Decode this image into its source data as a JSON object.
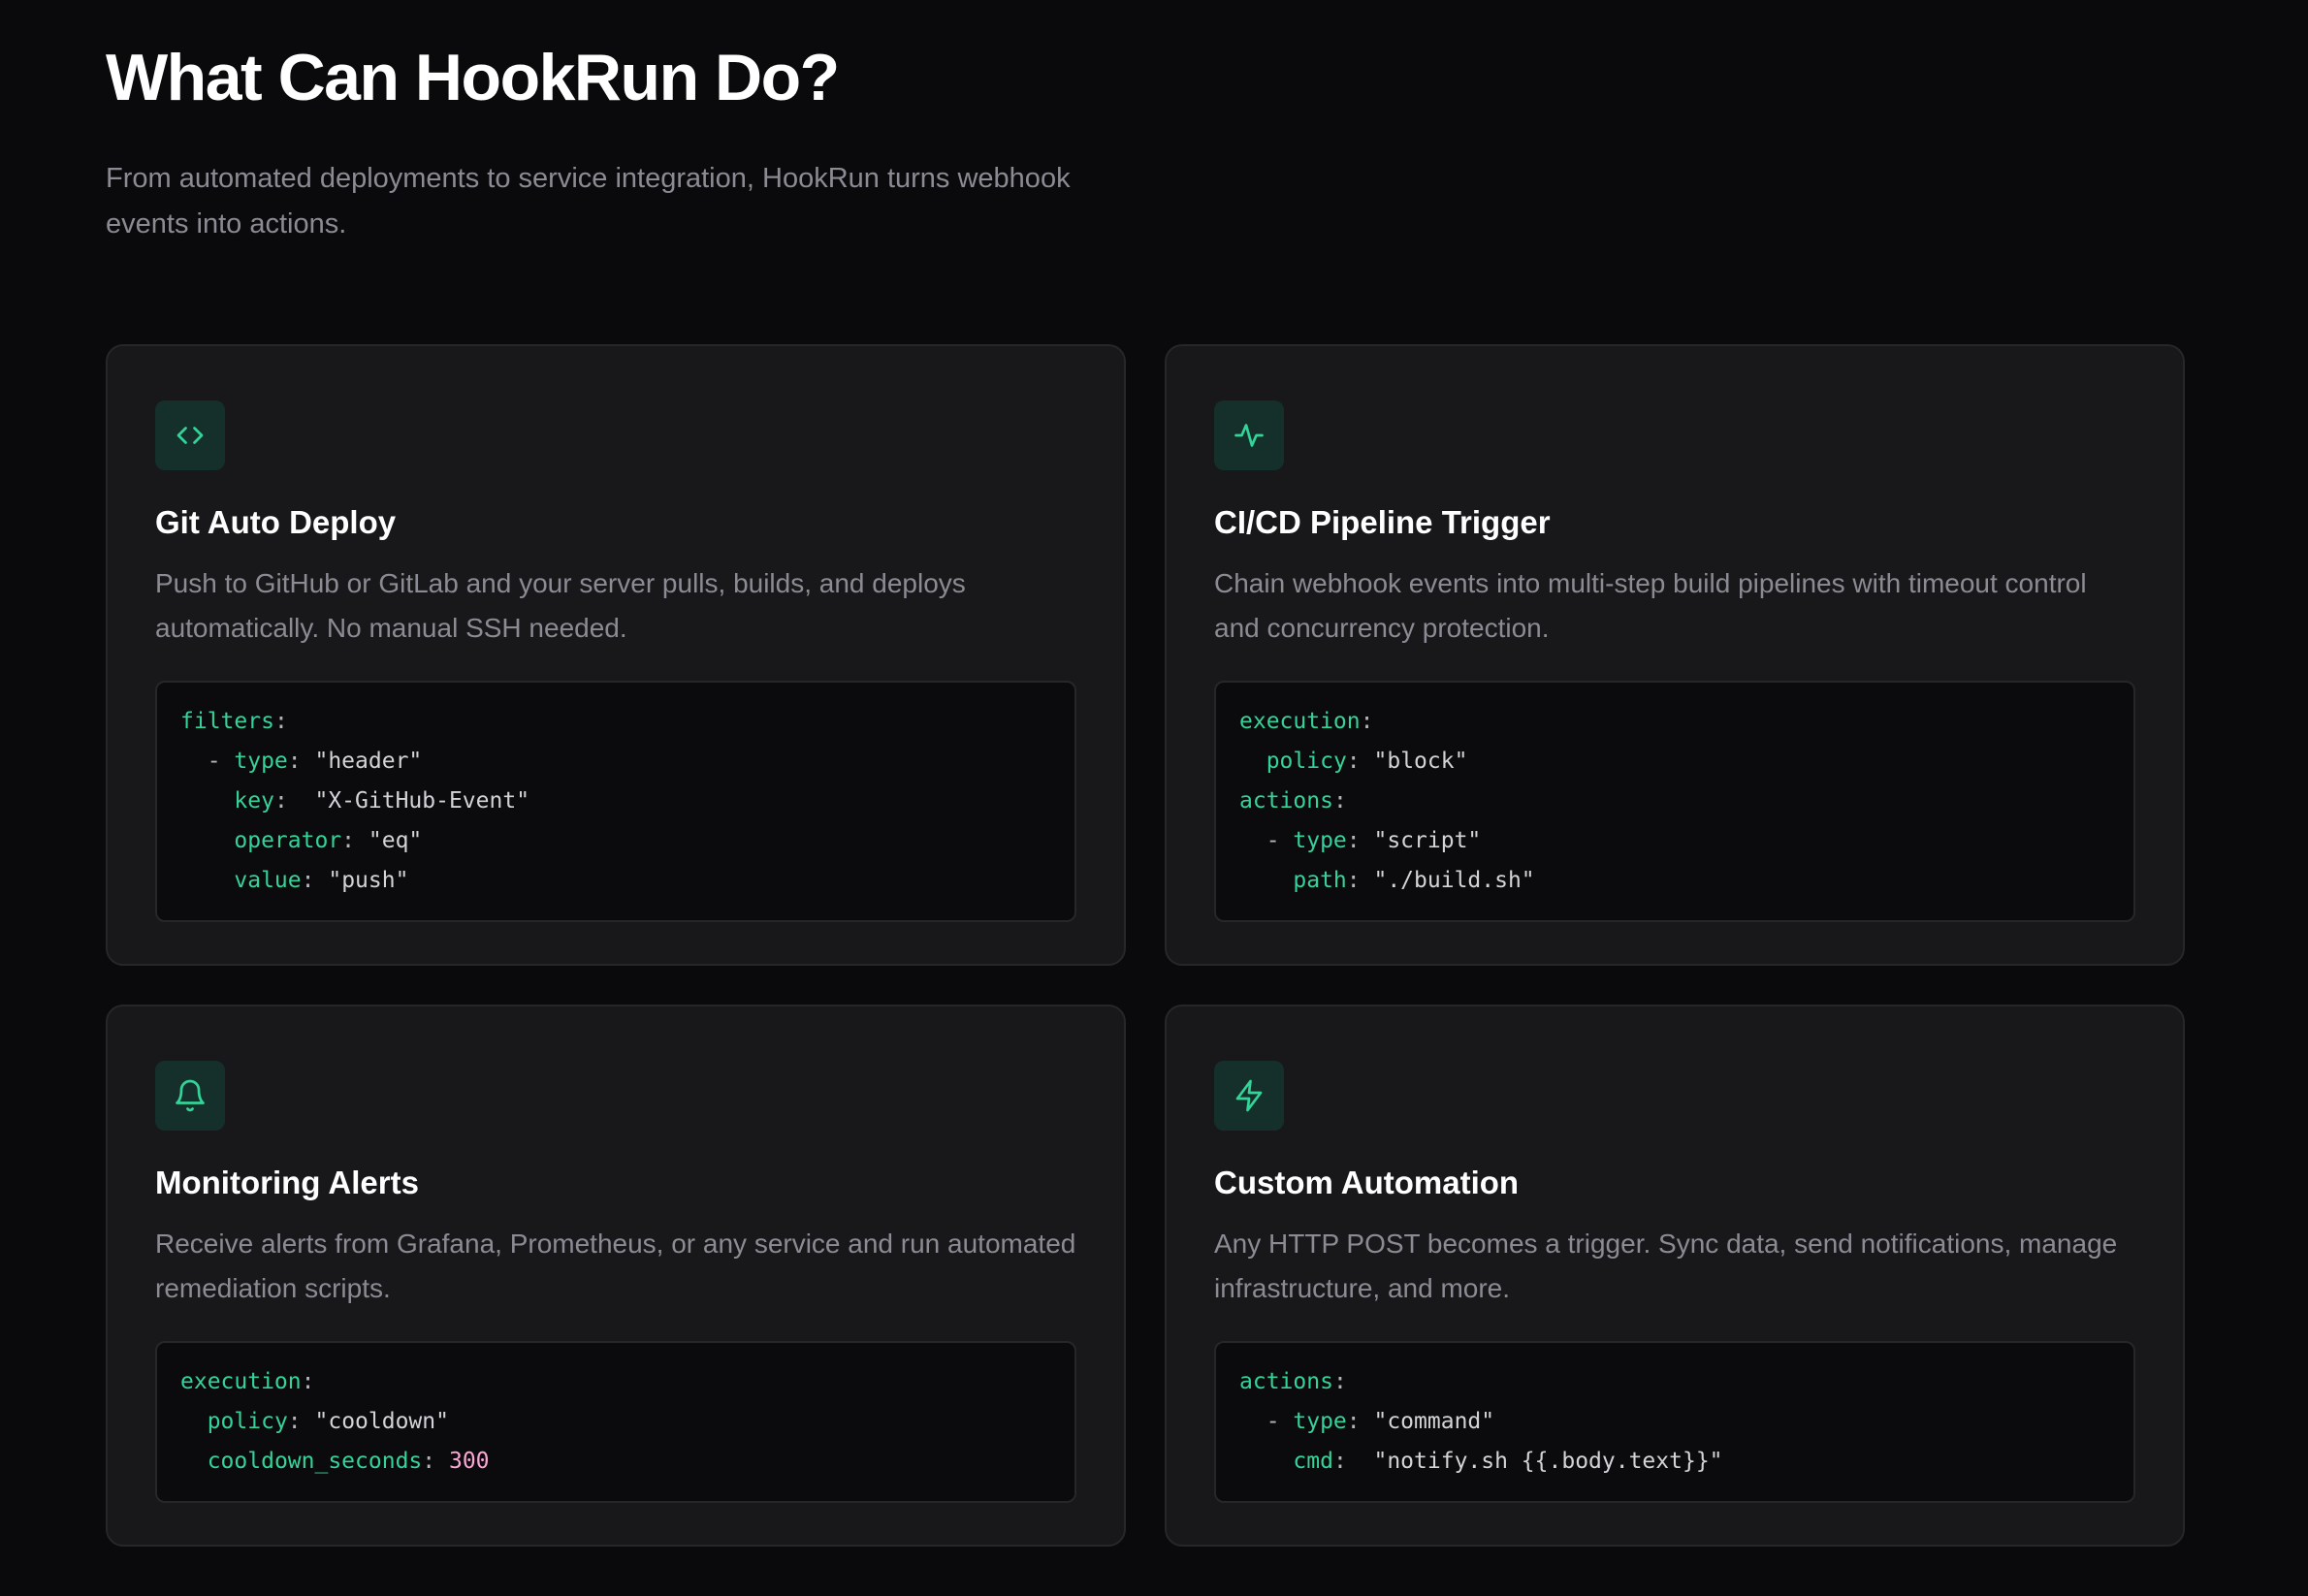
{
  "header": {
    "title": "What Can HookRun Do?",
    "subtitle": "From automated deployments to service integration, HookRun turns webhook events into actions."
  },
  "colors": {
    "background": "#0a0a0c",
    "card": "#18181b",
    "accent": "#34d399",
    "number": "#f9a8d4",
    "muted_text": "#8b8b93"
  },
  "cards": [
    {
      "icon": "code-icon",
      "title": "Git Auto Deploy",
      "description": "Push to GitHub or GitLab and your server pulls, builds, and deploys automatically. No manual SSH needed.",
      "code": [
        [
          {
            "t": "k",
            "v": "filters"
          },
          {
            "t": "p",
            "v": ":"
          }
        ],
        [
          {
            "t": "p",
            "v": "  - "
          },
          {
            "t": "k",
            "v": "type"
          },
          {
            "t": "p",
            "v": ": "
          },
          {
            "t": "s",
            "v": "\"header\""
          }
        ],
        [
          {
            "t": "p",
            "v": "    "
          },
          {
            "t": "k",
            "v": "key"
          },
          {
            "t": "p",
            "v": ":  "
          },
          {
            "t": "s",
            "v": "\"X-GitHub-Event\""
          }
        ],
        [
          {
            "t": "p",
            "v": "    "
          },
          {
            "t": "k",
            "v": "operator"
          },
          {
            "t": "p",
            "v": ": "
          },
          {
            "t": "s",
            "v": "\"eq\""
          }
        ],
        [
          {
            "t": "p",
            "v": "    "
          },
          {
            "t": "k",
            "v": "value"
          },
          {
            "t": "p",
            "v": ": "
          },
          {
            "t": "s",
            "v": "\"push\""
          }
        ]
      ]
    },
    {
      "icon": "activity-icon",
      "title": "CI/CD Pipeline Trigger",
      "description": "Chain webhook events into multi-step build pipelines with timeout control and concurrency protection.",
      "code": [
        [
          {
            "t": "k",
            "v": "execution"
          },
          {
            "t": "p",
            "v": ":"
          }
        ],
        [
          {
            "t": "p",
            "v": "  "
          },
          {
            "t": "k",
            "v": "policy"
          },
          {
            "t": "p",
            "v": ": "
          },
          {
            "t": "s",
            "v": "\"block\""
          }
        ],
        [
          {
            "t": "k",
            "v": "actions"
          },
          {
            "t": "p",
            "v": ":"
          }
        ],
        [
          {
            "t": "p",
            "v": "  - "
          },
          {
            "t": "k",
            "v": "type"
          },
          {
            "t": "p",
            "v": ": "
          },
          {
            "t": "s",
            "v": "\"script\""
          }
        ],
        [
          {
            "t": "p",
            "v": "    "
          },
          {
            "t": "k",
            "v": "path"
          },
          {
            "t": "p",
            "v": ": "
          },
          {
            "t": "s",
            "v": "\"./build.sh\""
          }
        ]
      ]
    },
    {
      "icon": "bell-icon",
      "title": "Monitoring Alerts",
      "description": "Receive alerts from Grafana, Prometheus, or any service and run automated remediation scripts.",
      "code": [
        [
          {
            "t": "k",
            "v": "execution"
          },
          {
            "t": "p",
            "v": ":"
          }
        ],
        [
          {
            "t": "p",
            "v": "  "
          },
          {
            "t": "k",
            "v": "policy"
          },
          {
            "t": "p",
            "v": ": "
          },
          {
            "t": "s",
            "v": "\"cooldown\""
          }
        ],
        [
          {
            "t": "p",
            "v": "  "
          },
          {
            "t": "k",
            "v": "cooldown_seconds"
          },
          {
            "t": "p",
            "v": ": "
          },
          {
            "t": "n",
            "v": "300"
          }
        ]
      ]
    },
    {
      "icon": "lightning-icon",
      "title": "Custom Automation",
      "description": "Any HTTP POST becomes a trigger. Sync data, send notifications, manage infrastructure, and more.",
      "code": [
        [
          {
            "t": "k",
            "v": "actions"
          },
          {
            "t": "p",
            "v": ":"
          }
        ],
        [
          {
            "t": "p",
            "v": "  - "
          },
          {
            "t": "k",
            "v": "type"
          },
          {
            "t": "p",
            "v": ": "
          },
          {
            "t": "s",
            "v": "\"command\""
          }
        ],
        [
          {
            "t": "p",
            "v": "    "
          },
          {
            "t": "k",
            "v": "cmd"
          },
          {
            "t": "p",
            "v": ":  "
          },
          {
            "t": "s",
            "v": "\"notify.sh {{.body.text}}\""
          }
        ]
      ]
    }
  ]
}
